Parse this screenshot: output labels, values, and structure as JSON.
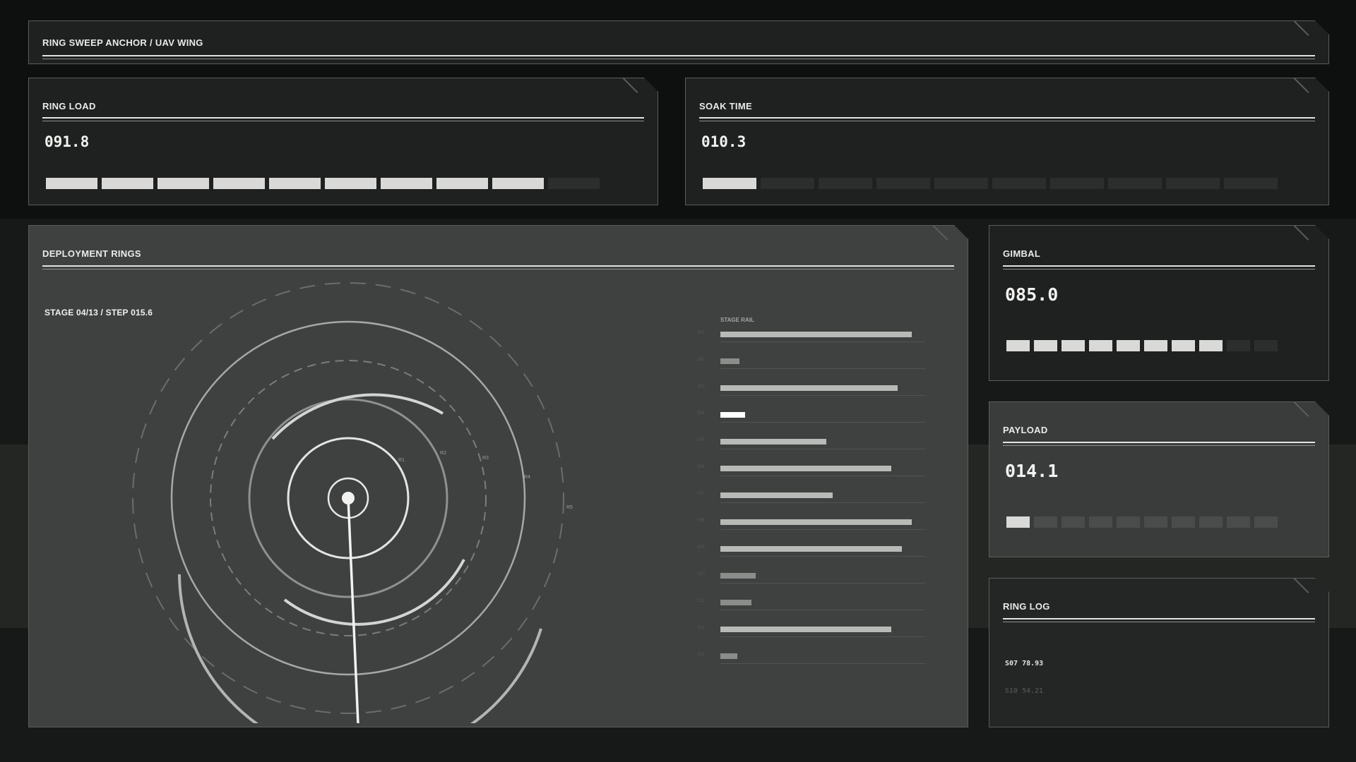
{
  "header": {
    "title": "RING SWEEP ANCHOR / UAV WING"
  },
  "ring_load": {
    "title": "RING LOAD",
    "value": "091.8",
    "segments_total": 10,
    "segments_on": 9
  },
  "soak_time": {
    "title": "SOAK TIME",
    "value": "010.3",
    "segments_total": 10,
    "segments_on": 1
  },
  "deployment": {
    "title": "DEPLOYMENT RINGS",
    "stage_label": "STAGE 04/13 / STEP 015.6",
    "ring_labels": [
      "R1",
      "R2",
      "R3",
      "R4",
      "R5"
    ],
    "rail_title": "STAGE RAIL",
    "rail": [
      {
        "tick": "S01",
        "value": 0.92
      },
      {
        "tick": "S02",
        "value": 0.09
      },
      {
        "tick": "S03",
        "value": 0.85
      },
      {
        "tick": "S04",
        "value": 0.12,
        "active": true
      },
      {
        "tick": "S05",
        "value": 0.51
      },
      {
        "tick": "S06",
        "value": 0.82
      },
      {
        "tick": "S07",
        "value": 0.54
      },
      {
        "tick": "S08",
        "value": 0.92
      },
      {
        "tick": "S09",
        "value": 0.87
      },
      {
        "tick": "S10",
        "value": 0.17
      },
      {
        "tick": "S11",
        "value": 0.15
      },
      {
        "tick": "S12",
        "value": 0.82
      },
      {
        "tick": "S13",
        "value": 0.08
      }
    ]
  },
  "gimbal": {
    "title": "GIMBAL",
    "value": "085.0",
    "segments_total": 10,
    "segments_on": 8
  },
  "payload": {
    "title": "PAYLOAD",
    "value": "014.1",
    "segments_total": 10,
    "segments_on": 1
  },
  "ring_log": {
    "title": "RING LOG",
    "entries": [
      "S07 78.93",
      "S10 54.21"
    ]
  },
  "colors": {
    "accent": "#e3e4e2",
    "segment_on": "#d9dad8",
    "segment_off": "#2c2e2d"
  }
}
